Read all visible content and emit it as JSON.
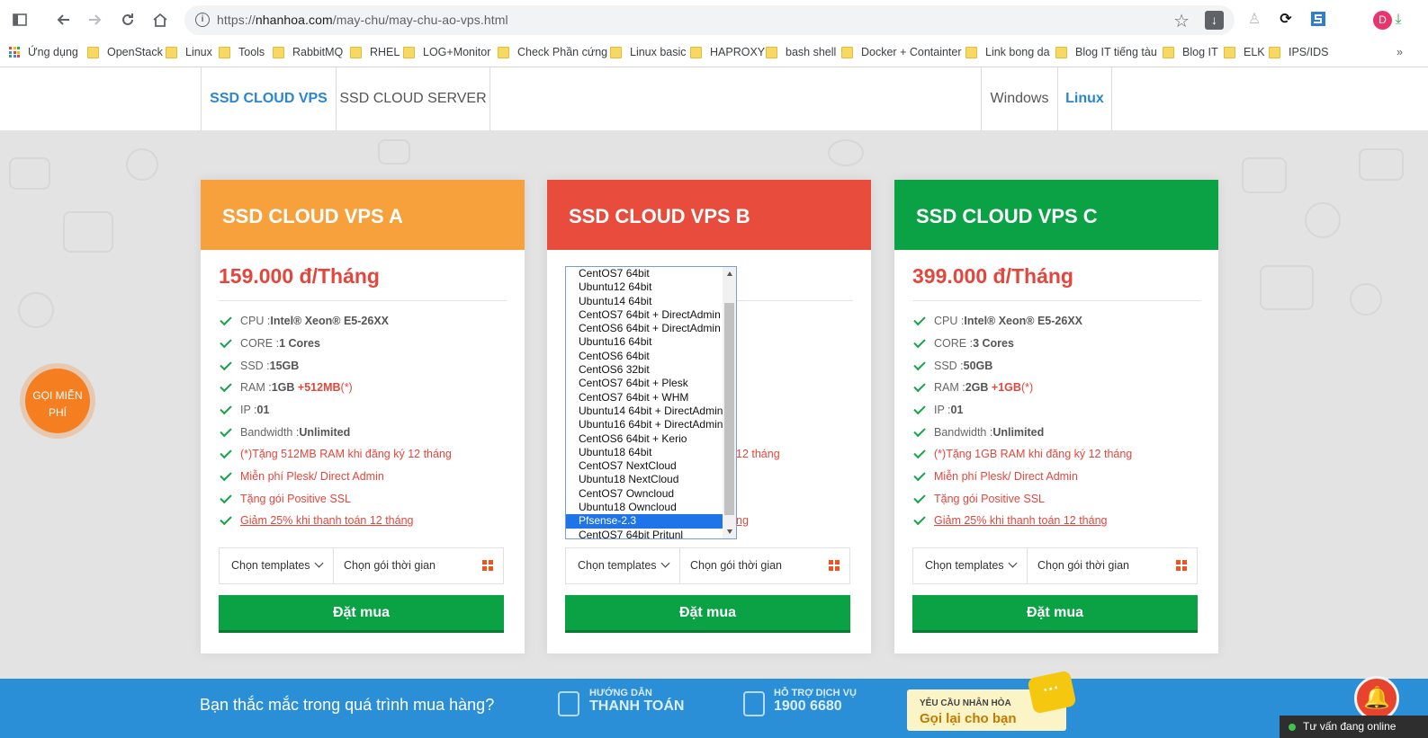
{
  "browser": {
    "url_prefix": "https://",
    "url_host": "nhanhoa.com",
    "url_path": "/may-chu/may-chu-ao-vps.html",
    "avatar_letter": "D"
  },
  "bookmarks": {
    "apps_label": "Ứng dụng",
    "items": [
      "OpenStack",
      "Linux",
      "Tools",
      "RabbitMQ",
      "RHEL",
      "LOG+Monitor",
      "Check Phần cứng",
      "Linux basic",
      "HAPROXY",
      "bash shell",
      "Docker + Containter",
      "Link bong da",
      "Blog IT tiếng tàu",
      "Blog IT",
      "ELK",
      "IPS/IDS"
    ]
  },
  "nav": {
    "tab_vps": "SSD CLOUD VPS",
    "tab_server": "SSD CLOUD SERVER",
    "tab_windows": "Windows",
    "tab_linux": "Linux"
  },
  "call_button": {
    "line1": "GỌI MIỄN",
    "line2": "PHÍ"
  },
  "cards": [
    {
      "title": "SSD CLOUD VPS A",
      "color": "#f7a13c",
      "price": "159.000 đ/Tháng",
      "cpu_label": "CPU : ",
      "cpu": "Intel® Xeon® E5-26XX",
      "core_label": "CORE : ",
      "core": "1 Cores",
      "ssd_label": "SSD : ",
      "ssd": "15GB",
      "ram_label": "RAM : ",
      "ram": "1GB",
      "ram_bonus": "+512MB",
      "ram_note": "(*)",
      "ip_label": "IP : ",
      "ip": "01",
      "bw_label": "Bandwidth : ",
      "bw": "Unlimited",
      "promo1": "(*)Tặng 512MB RAM khi đăng ký 12 tháng",
      "promo2": "Miễn phí Plesk/ Direct Admin",
      "promo3": "Tặng gói Positive SSL",
      "promo4": "Giảm 25% khi thanh toán 12 tháng",
      "select_templates": "Chọn templates",
      "select_period": "Chọn gói thời gian",
      "buy": "Đặt mua"
    },
    {
      "title": "SSD CLOUD VPS B",
      "color": "#e74c3c",
      "promo1_tail": "12 tháng",
      "promo4_tail": "ng",
      "select_templates": "Chọn templates",
      "select_period": "Chọn gói thời gian",
      "buy": "Đặt mua"
    },
    {
      "title": "SSD CLOUD VPS C",
      "color": "#0aa245",
      "price": "399.000 đ/Tháng",
      "cpu_label": "CPU : ",
      "cpu": "Intel® Xeon® E5-26XX",
      "core_label": "CORE : ",
      "core": "3 Cores",
      "ssd_label": "SSD : ",
      "ssd": "50GB",
      "ram_label": "RAM : ",
      "ram": "2GB",
      "ram_bonus": "+1GB",
      "ram_note": "(*)",
      "ip_label": "IP : ",
      "ip": "01",
      "bw_label": "Bandwidth : ",
      "bw": "Unlimited",
      "promo1": "(*)Tặng 1GB RAM khi đăng ký 12 tháng",
      "promo2": "Miễn phí Plesk/ Direct Admin",
      "promo3": "Tặng gói Positive SSL",
      "promo4": "Giảm 25% khi thanh toán 12 tháng",
      "select_templates": "Chọn templates",
      "select_period": "Chọn gói thời gian",
      "buy": "Đặt mua"
    }
  ],
  "template_dropdown": {
    "options": [
      "CentOS7 64bit",
      "Ubuntu12 64bit",
      "Ubuntu14 64bit",
      "CentOS7 64bit + DirectAdmin",
      "CentOS6 64bit + DirectAdmin",
      "Ubuntu16 64bit",
      "CentOS6 64bit",
      "CentOS6 32bit",
      "CentOS7 64bit + Plesk",
      "CentOS7 64bit + WHM",
      "Ubuntu14 64bit + DirectAdmin",
      "Ubuntu16 64bit + DirectAdmin",
      "CentOS6 64bit + Kerio",
      "Ubuntu18 64bit",
      "CentOS7 NextCloud",
      "Ubuntu18 NextCloud",
      "CentOS7 Owncloud",
      "Ubuntu18 Owncloud",
      "Pfsense-2.3",
      "CentOS7 64bit Pritunl"
    ],
    "selected": "Pfsense-2.3"
  },
  "footer": {
    "question": "Bạn thắc mắc trong quá trình mua hàng?",
    "guide_small": "HƯỚNG DẪN",
    "guide_big": "THANH TOÁN",
    "support_small": "HỖ TRỢ DỊCH VỤ",
    "support_big": "1900 6680",
    "request_small": "YÊU CẦU NHÂN HÒA",
    "request_big": "Gọi lại cho bạn",
    "chat": "Tư vấn đang online"
  },
  "colors": {
    "accent": "#2a86d0",
    "price": "#e4463c",
    "buy": "#0aa245",
    "footer": "#2b8fd7"
  }
}
